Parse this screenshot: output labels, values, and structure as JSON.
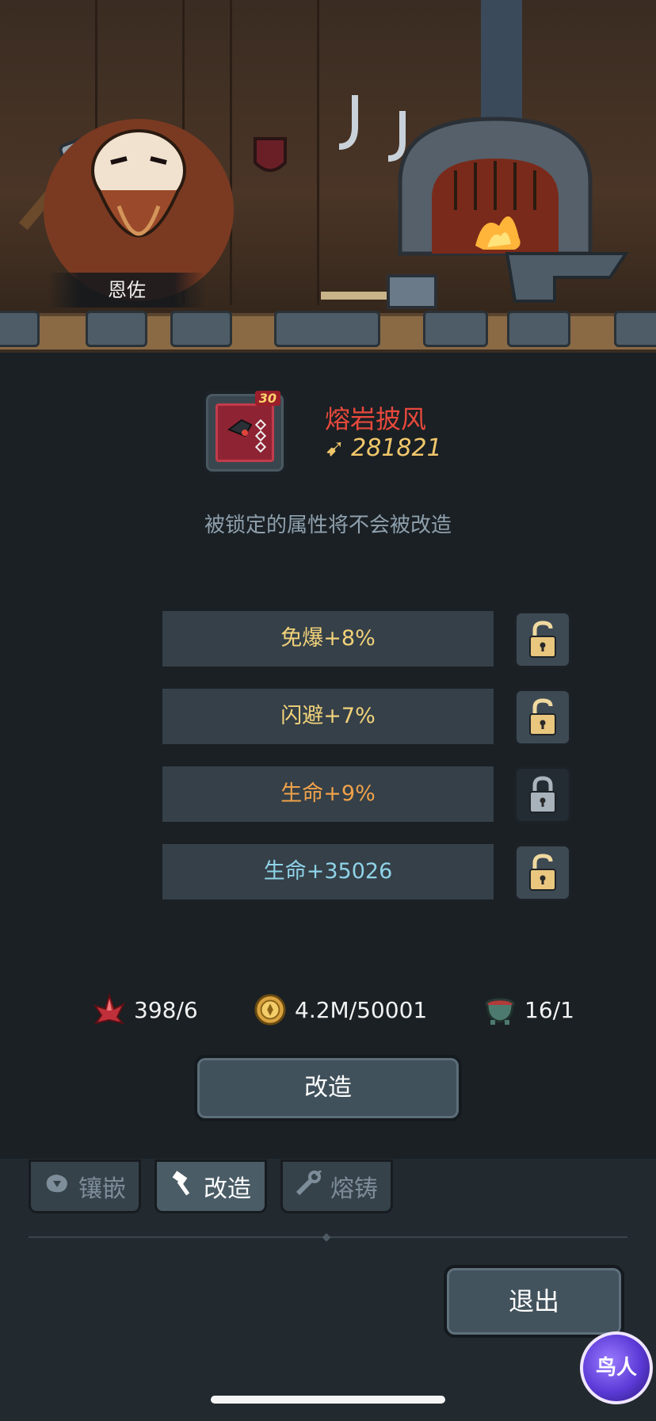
{
  "npc": {
    "name": "恩佐"
  },
  "item": {
    "name": "熔岩披风",
    "level": "30",
    "power": "281821",
    "power_icon": "power-icon"
  },
  "hint": "被锁定的属性将不会被改造",
  "attributes": [
    {
      "label": "免爆+8%",
      "color": "#f2d27a",
      "locked": false
    },
    {
      "label": "闪避+7%",
      "color": "#f2d27a",
      "locked": false
    },
    {
      "label": "生命+9%",
      "color": "#f0a24a",
      "locked": true
    },
    {
      "label": "生命+35026",
      "color": "#8fd3e8",
      "locked": false
    }
  ],
  "resources": [
    {
      "icon": "crystal-icon",
      "value": "398/6"
    },
    {
      "icon": "gold-coin-icon",
      "value": "4.2M/50001"
    },
    {
      "icon": "cauldron-icon",
      "value": "16/1"
    }
  ],
  "actions": {
    "reforge": "改造",
    "exit": "退出"
  },
  "tabs": [
    {
      "label": "镶嵌",
      "icon": "gem-icon",
      "active": false
    },
    {
      "label": "改造",
      "icon": "hammer-icon",
      "active": true
    },
    {
      "label": "熔铸",
      "icon": "wrench-icon",
      "active": false
    }
  ],
  "badge": "鸟人"
}
